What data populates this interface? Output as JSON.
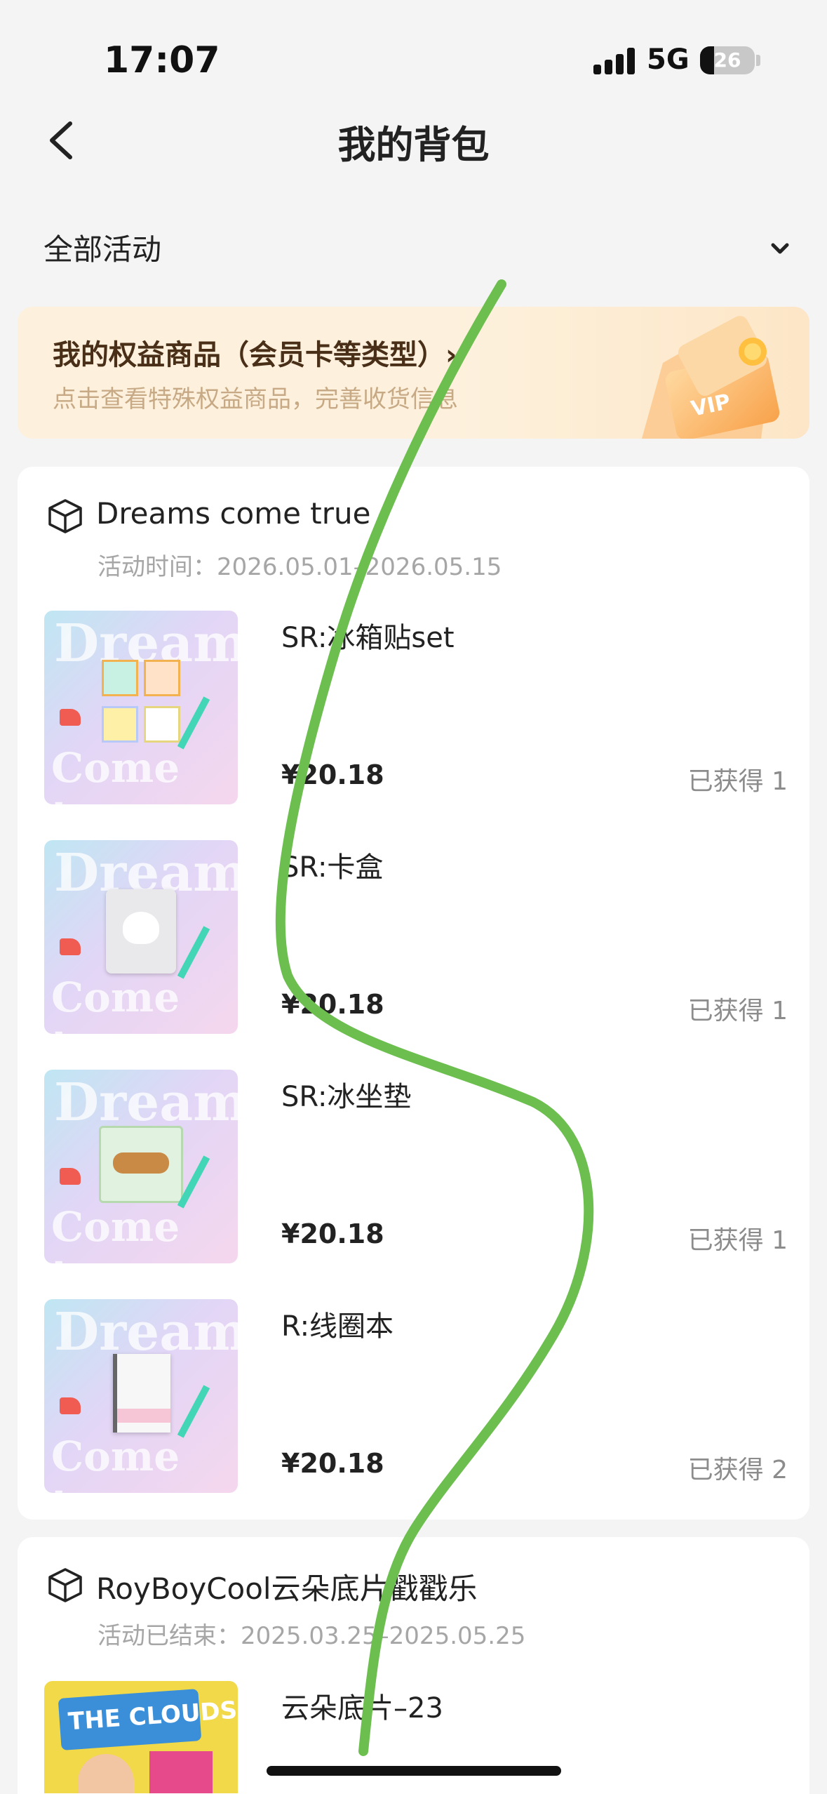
{
  "status_bar": {
    "time": "17:07",
    "network": "5G",
    "battery": "26",
    "battery_level": 0.26
  },
  "nav": {
    "title": "我的背包"
  },
  "filter": {
    "label": "全部活动"
  },
  "banner": {
    "title": "我的权益商品（会员卡等类型）›",
    "subtitle": "点击查看特殊权益商品，完善收货信息",
    "art_text": "VIP"
  },
  "activities": [
    {
      "title": "Dreams come true",
      "time": "活动时间：2026.05.01–2026.05.15",
      "items": [
        {
          "name": "SR:冰箱贴set",
          "price": "¥20.18",
          "count": "已获得 1"
        },
        {
          "name": "SR:卡盒",
          "price": "¥20.18",
          "count": "已获得 1"
        },
        {
          "name": "SR:冰坐垫",
          "price": "¥20.18",
          "count": "已获得 1"
        },
        {
          "name": "R:线圈本",
          "price": "¥20.18",
          "count": "已获得 2"
        }
      ]
    },
    {
      "title": "RoyBoyCool云朵底片戳戳乐",
      "time": "活动已结束：2025.03.25–2025.05.25",
      "items": [
        {
          "name": "云朵底片–23",
          "thumb_text": "THE CLOUDS"
        }
      ]
    }
  ],
  "thumb_text": {
    "top": "Dreams",
    "bottom": "Come true"
  },
  "colors": {
    "scribble": "#6cbf4f",
    "banner_title": "#4a2f18",
    "banner_sub": "#c7aa85"
  }
}
